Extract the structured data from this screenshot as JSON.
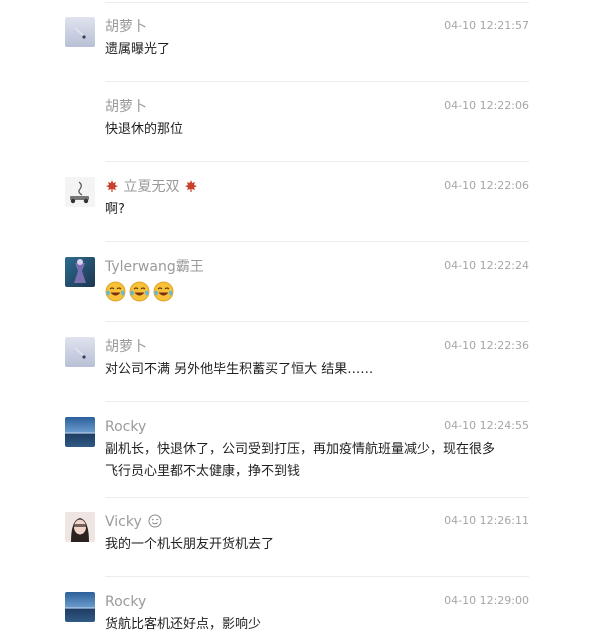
{
  "comments": [
    {
      "nickname": "胡萝卜",
      "time": "04-10 12:21:57",
      "content": "遗属曝光了",
      "avatar_icon": "sky-avatar-icon"
    },
    {
      "nickname": "胡萝卜",
      "time": "04-10 12:22:06",
      "content": "快退休的那位",
      "avatar_icon": ""
    },
    {
      "nickname": "立夏无双",
      "time": "04-10 12:22:06",
      "content": "啊?",
      "avatar_icon": "scooter-avatar-icon",
      "badge_icon": "maple-leaf-icon"
    },
    {
      "nickname": "Tylerwang霸王",
      "time": "04-10 12:22:24",
      "content": "",
      "avatar_icon": "figure-avatar-icon",
      "emojis": [
        "laugh-cry-icon",
        "laugh-cry-icon",
        "laugh-cry-icon"
      ]
    },
    {
      "nickname": "胡萝卜",
      "time": "04-10 12:22:36",
      "content": "对公司不满 另外他毕生积蓄买了恒大 结果……",
      "avatar_icon": "sky-avatar-icon"
    },
    {
      "nickname": "Rocky",
      "time": "04-10 12:24:55",
      "content": "副机长，快退休了，公司受到打压，再加疫情航班量减少，现在很多飞行员心里都不太健康，挣不到钱",
      "avatar_icon": "sea-avatar-icon"
    },
    {
      "nickname": "Vicky",
      "time": "04-10 12:26:11",
      "content": "我的一个机长朋友开货机去了",
      "avatar_icon": "portrait-avatar-icon",
      "name_icon": "wink-emoji-icon"
    },
    {
      "nickname": "Rocky",
      "time": "04-10 12:29:00",
      "content": "货航比客机还好点，影响少",
      "avatar_icon": "sea-avatar-icon"
    }
  ],
  "colors": {
    "nickname": "#9a9a9a",
    "time": "#a6a6a6",
    "content": "#1f1f1f",
    "divider": "#ececec"
  }
}
